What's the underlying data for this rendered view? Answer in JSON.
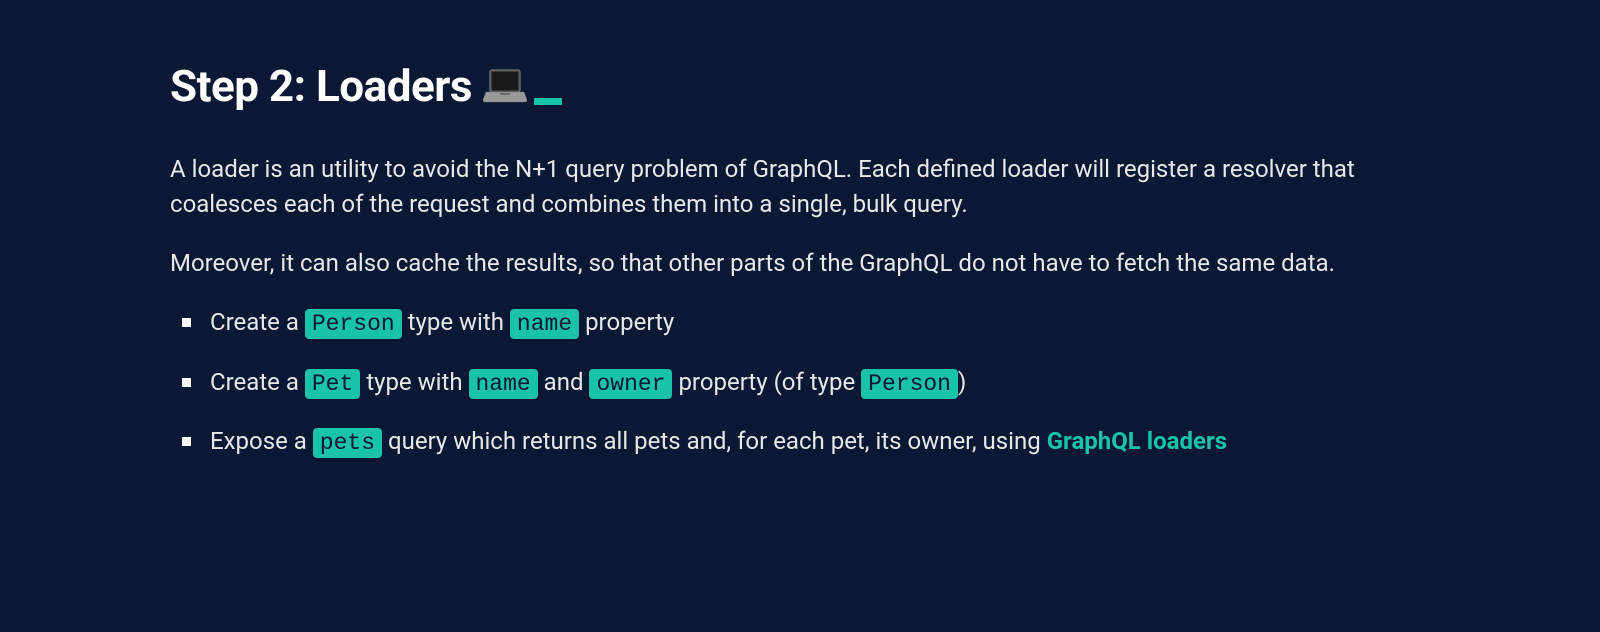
{
  "heading": "Step 2: Loaders",
  "para1": "A loader is an utility to avoid the N+1 query problem of GraphQL. Each defined loader will register a resolver that coalesces each of the request and combines them into a single, bulk query.",
  "para2": "Moreover, it can also cache the results, so that other parts of the GraphQL do not have to fetch the same data.",
  "bullets": {
    "b1": {
      "t1": "Create a ",
      "c1": "Person",
      "t2": " type with ",
      "c2": "name",
      "t3": " property"
    },
    "b2": {
      "t1": "Create a ",
      "c1": "Pet",
      "t2": " type with ",
      "c2": "name",
      "t3": " and ",
      "c3": "owner",
      "t4": " property (of type ",
      "c4": "Person",
      "t5": ")"
    },
    "b3": {
      "t1": "Expose a ",
      "c1": "pets",
      "t2": " query which returns all pets and, for each pet, its owner, using ",
      "link": "GraphQL loaders"
    }
  }
}
